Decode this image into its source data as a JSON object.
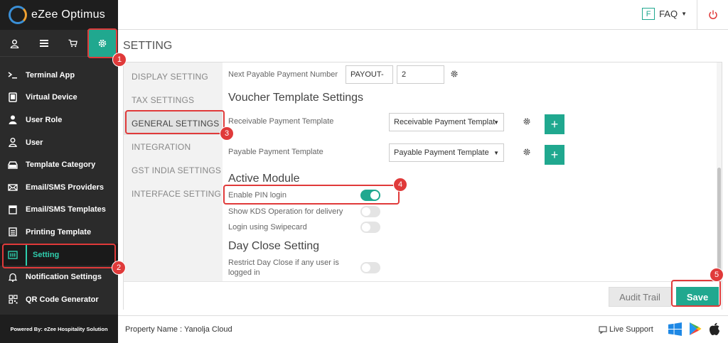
{
  "app": {
    "name": "eZee Optimus"
  },
  "icon_tabs": [
    {
      "icon": "user-icon"
    },
    {
      "icon": "menu-icon"
    },
    {
      "icon": "cart-icon"
    },
    {
      "icon": "gear-icon",
      "active": true
    }
  ],
  "sidebar": {
    "items": [
      {
        "label": "Terminal App",
        "icon": "terminal-icon"
      },
      {
        "label": "Virtual Device",
        "icon": "tablet-icon"
      },
      {
        "label": "User Role",
        "icon": "user-role-icon"
      },
      {
        "label": "User",
        "icon": "user-icon"
      },
      {
        "label": "Template Category",
        "icon": "tray-icon"
      },
      {
        "label": "Email/SMS Providers",
        "icon": "envelope-icon"
      },
      {
        "label": "Email/SMS Templates",
        "icon": "browser-icon"
      },
      {
        "label": "Printing Template",
        "icon": "document-icon"
      },
      {
        "label": "Setting",
        "icon": "setting-icon",
        "active": true
      },
      {
        "label": "Notification Settings",
        "icon": "bell-icon"
      },
      {
        "label": "QR Code Generator",
        "icon": "qr-icon"
      }
    ],
    "powered_by": "Powered By: eZee Hospitality Solution"
  },
  "topbar": {
    "faq_badge": "F",
    "faq_label": "FAQ"
  },
  "page_title": "SETTING",
  "left_nav": [
    {
      "label": "DISPLAY SETTING"
    },
    {
      "label": "TAX SETTINGS"
    },
    {
      "label": "GENERAL SETTINGS",
      "active": true
    },
    {
      "label": "INTEGRATION"
    },
    {
      "label": "GST INDIA SETTINGS"
    },
    {
      "label": "INTERFACE SETTING"
    }
  ],
  "form": {
    "next_payable_label": "Next Payable Payment Number",
    "next_payable_prefix": "PAYOUT-",
    "next_payable_number": "2",
    "voucher_title": "Voucher Template Settings",
    "receivable_label": "Receivable Payment Template",
    "receivable_value": "Receivable Payment Templat",
    "payable_label": "Payable Payment Template",
    "payable_value": "Payable Payment Template",
    "active_module_title": "Active Module",
    "toggles": [
      {
        "label": "Enable PIN login",
        "on": true
      },
      {
        "label": "Show KDS Operation for delivery",
        "on": false
      },
      {
        "label": "Login using Swipecard",
        "on": false
      }
    ],
    "day_close_title": "Day Close Setting",
    "day_close_label": "Restrict Day Close if any user is logged in",
    "day_close_on": false
  },
  "footer": {
    "audit_trail": "Audit Trail",
    "save": "Save"
  },
  "status": {
    "property": "Property Name : Yanolja Cloud",
    "live_support": "Live Support"
  },
  "callouts": [
    "1",
    "2",
    "3",
    "4",
    "5"
  ],
  "colors": {
    "accent": "#20a88f",
    "callout": "#e03a3a",
    "sidebar": "#2b2b2b"
  }
}
